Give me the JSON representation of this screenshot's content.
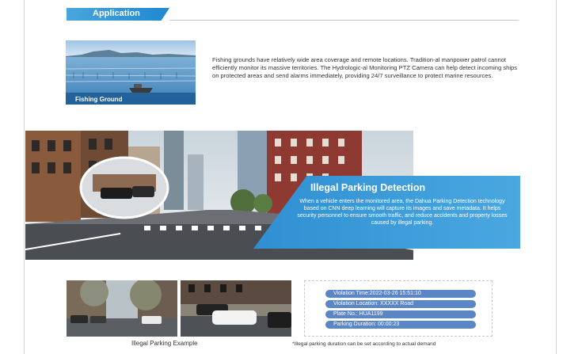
{
  "header": {
    "title": "Application"
  },
  "fishing": {
    "label": "Fishing Ground",
    "text": "Fishing grounds have relatively wide area coverage and remote locations. Tradition-al manpower patrol cannot efficiently monitor its massive territories. The Hydrologic-al Monitoring PTZ Camera can help detect incoming ships on protected areas and send alarms immediately, providing 24/7 surveillance to protect marine resources."
  },
  "illegal": {
    "title": "Illegal Parking Detection",
    "text": "When a vehicle enters the monitored area, the Dahua Parking Detection technology based on CNN deep learning will capture its images and save metadata. It helps security personnel to ensure smooth traffic, and reduce accidents and property losses caused by illegal parking."
  },
  "example": {
    "caption": "Illegal Parking Example",
    "violation_time": "Violation Time:2022-03-26 15:51:10",
    "violation_location": "Violation Location: XXXXX Road",
    "plate_no": "Plate No.: HUA1199",
    "parking_duration": "Parking Duration: 00:00:23",
    "footnote": "*Illegal parking duration can be set according to actual demand"
  }
}
